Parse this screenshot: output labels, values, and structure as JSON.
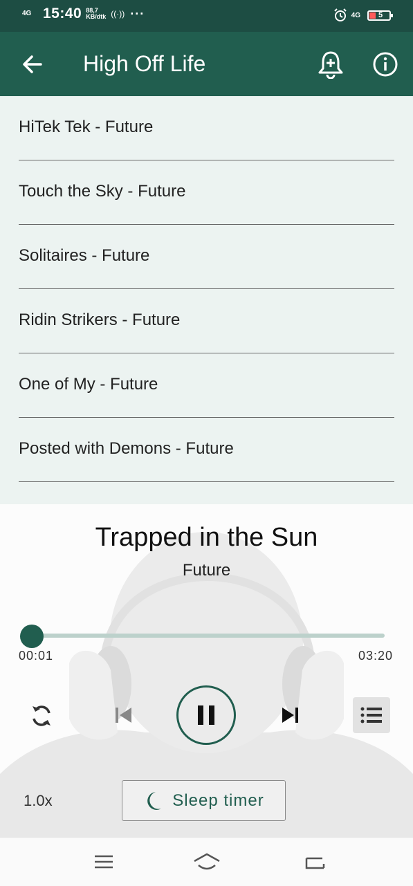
{
  "status_bar": {
    "network": "4G",
    "time": "15:40",
    "speed_value": "88,7",
    "speed_unit": "KB/dtk",
    "more": "···",
    "net_right": "4G",
    "battery": "5",
    "battery_color": "#ff5a5a"
  },
  "app_bar": {
    "title": "High Off Life",
    "color": "#215e4f",
    "icons": [
      "back-arrow-icon",
      "bell-plus-icon",
      "info-icon"
    ]
  },
  "tracks": [
    {
      "label": "HiTek Tek - Future"
    },
    {
      "label": "Touch the Sky - Future"
    },
    {
      "label": "Solitaires - Future"
    },
    {
      "label": "Ridin Strikers - Future"
    },
    {
      "label": "One of My - Future"
    },
    {
      "label": "Posted with Demons - Future"
    }
  ],
  "player": {
    "title": "Trapped in the Sun",
    "artist": "Future",
    "current_time": "00:01",
    "total_time": "03:20",
    "progress_fraction": 0.005,
    "speed": "1.0x",
    "sleep_timer_label": "Sleep timer",
    "state": "playing"
  }
}
